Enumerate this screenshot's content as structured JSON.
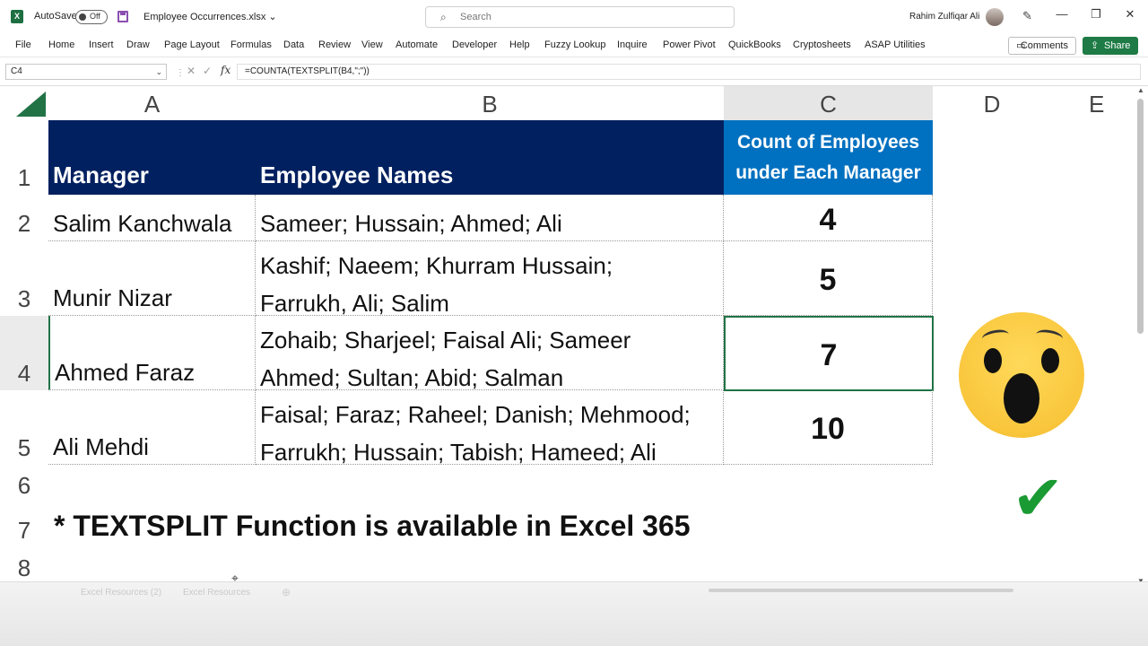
{
  "titlebar": {
    "autosave_label": "AutoSave",
    "autosave_state": "Off",
    "filename": "Employee Occurrences.xlsx",
    "filename_chevron": "⌄",
    "search_placeholder": "Search",
    "user_name": "Rahim Zulfiqar Ali",
    "minimize": "—",
    "restore": "❐",
    "close": "✕"
  },
  "ribbon": {
    "tabs": [
      "File",
      "Home",
      "Insert",
      "Draw",
      "Page Layout",
      "Formulas",
      "Data",
      "Review",
      "View",
      "Automate",
      "Developer",
      "Help",
      "Fuzzy Lookup",
      "Inquire",
      "Power Pivot",
      "QuickBooks",
      "Cryptosheets",
      "ASAP Utilities"
    ],
    "comments_label": "Comments",
    "share_label": "Share"
  },
  "formula_bar": {
    "name_box": "C4",
    "fx": "fx",
    "formula": "=COUNTA(TEXTSPLIT(B4,\";\"))"
  },
  "grid": {
    "columns": [
      "A",
      "B",
      "C",
      "D",
      "E"
    ],
    "rows": [
      "1",
      "2",
      "3",
      "4",
      "5",
      "6",
      "7",
      "8"
    ],
    "header": {
      "manager": "Manager",
      "employee_names": "Employee Names",
      "count_line1": "Count of Employees",
      "count_line2": "under Each Manager"
    },
    "records": [
      {
        "manager": "Salim Kanchwala",
        "names_line1": "Sameer; Hussain; Ahmed; Ali",
        "names_line2": "",
        "count": "4"
      },
      {
        "manager": "Munir Nizar",
        "names_line1": "Kashif; Naeem; Khurram Hussain;",
        "names_line2": "Farrukh, Ali; Salim",
        "count": "5"
      },
      {
        "manager": "Ahmed Faraz",
        "names_line1": "Zohaib; Sharjeel; Faisal Ali; Sameer",
        "names_line2": "Ahmed; Sultan; Abid; Salman",
        "count": "7"
      },
      {
        "manager": "Ali Mehdi",
        "names_line1": "Faisal; Faraz; Raheel; Danish; Mehmood;",
        "names_line2": "Farrukh; Hussain; Tabish; Hameed; Ali",
        "count": "10"
      }
    ],
    "note": "* TEXTSPLIT Function is available in Excel 365"
  },
  "sheets": [
    "Excel Resources (2)",
    "Excel Resources"
  ],
  "colors": {
    "navy_header": "#002060",
    "blue_header": "#0070c0",
    "excel_green": "#217346",
    "share_green": "#1e7b45"
  },
  "icons": [
    "excel-logo-icon",
    "save-icon",
    "search-icon",
    "pen-icon",
    "comments-icon",
    "share-icon",
    "shocked-face-icon",
    "checkmark-icon"
  ]
}
